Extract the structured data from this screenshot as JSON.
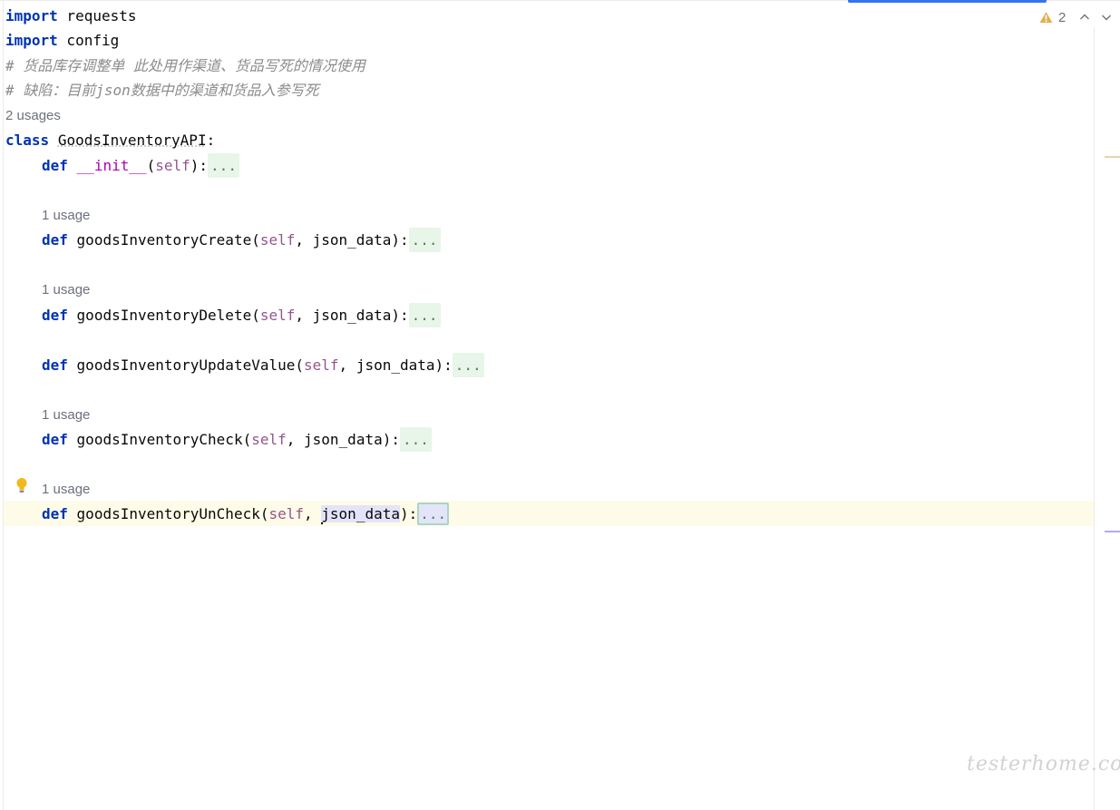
{
  "inspections": {
    "warning_count": "2"
  },
  "code": {
    "line1": {
      "kw": "import",
      "rest": " requests"
    },
    "line2": {
      "kw": "import",
      "rest": " config"
    },
    "comment1": "# 货品库存调整单 此处用作渠道、货品写死的情况使用",
    "comment2": "# 缺陷：目前json数据中的渠道和货品入参写死",
    "class_usages": "2 usages",
    "class_line": {
      "kw": "class",
      "name": "GoodsInventoryAPI",
      "colon": ":"
    },
    "init": {
      "kw": "def",
      "name": "__init__",
      "open": "(",
      "self": "self",
      "close": "):",
      "fold": "..."
    },
    "methods": [
      {
        "usage": "1 usage",
        "kw": "def",
        "name": "goodsInventoryCreate",
        "self": "self",
        "params": ", json_data):",
        "fold": "..."
      },
      {
        "usage": "1 usage",
        "kw": "def",
        "name": "goodsInventoryDelete",
        "self": "self",
        "params": ", json_data):",
        "fold": "..."
      },
      {
        "usage": "",
        "kw": "def",
        "name": "goodsInventoryUpdateValue",
        "self": "self",
        "params": ", json_data):",
        "fold": "..."
      },
      {
        "usage": "1 usage",
        "kw": "def",
        "name": "goodsInventoryCheck",
        "self": "self",
        "params": ", json_data):",
        "fold": "..."
      },
      {
        "usage": "1 usage",
        "kw": "def",
        "name": "goodsInventoryUnCheck",
        "self": "self",
        "sep": ", ",
        "param_hl": "json_data",
        "tail": "):",
        "fold": "..."
      }
    ]
  },
  "watermark": "testerhome.com",
  "colors": {
    "keyword": "#0033b3",
    "comment": "#8c8c8c",
    "self": "#94558d",
    "accent": "#3574f0"
  }
}
